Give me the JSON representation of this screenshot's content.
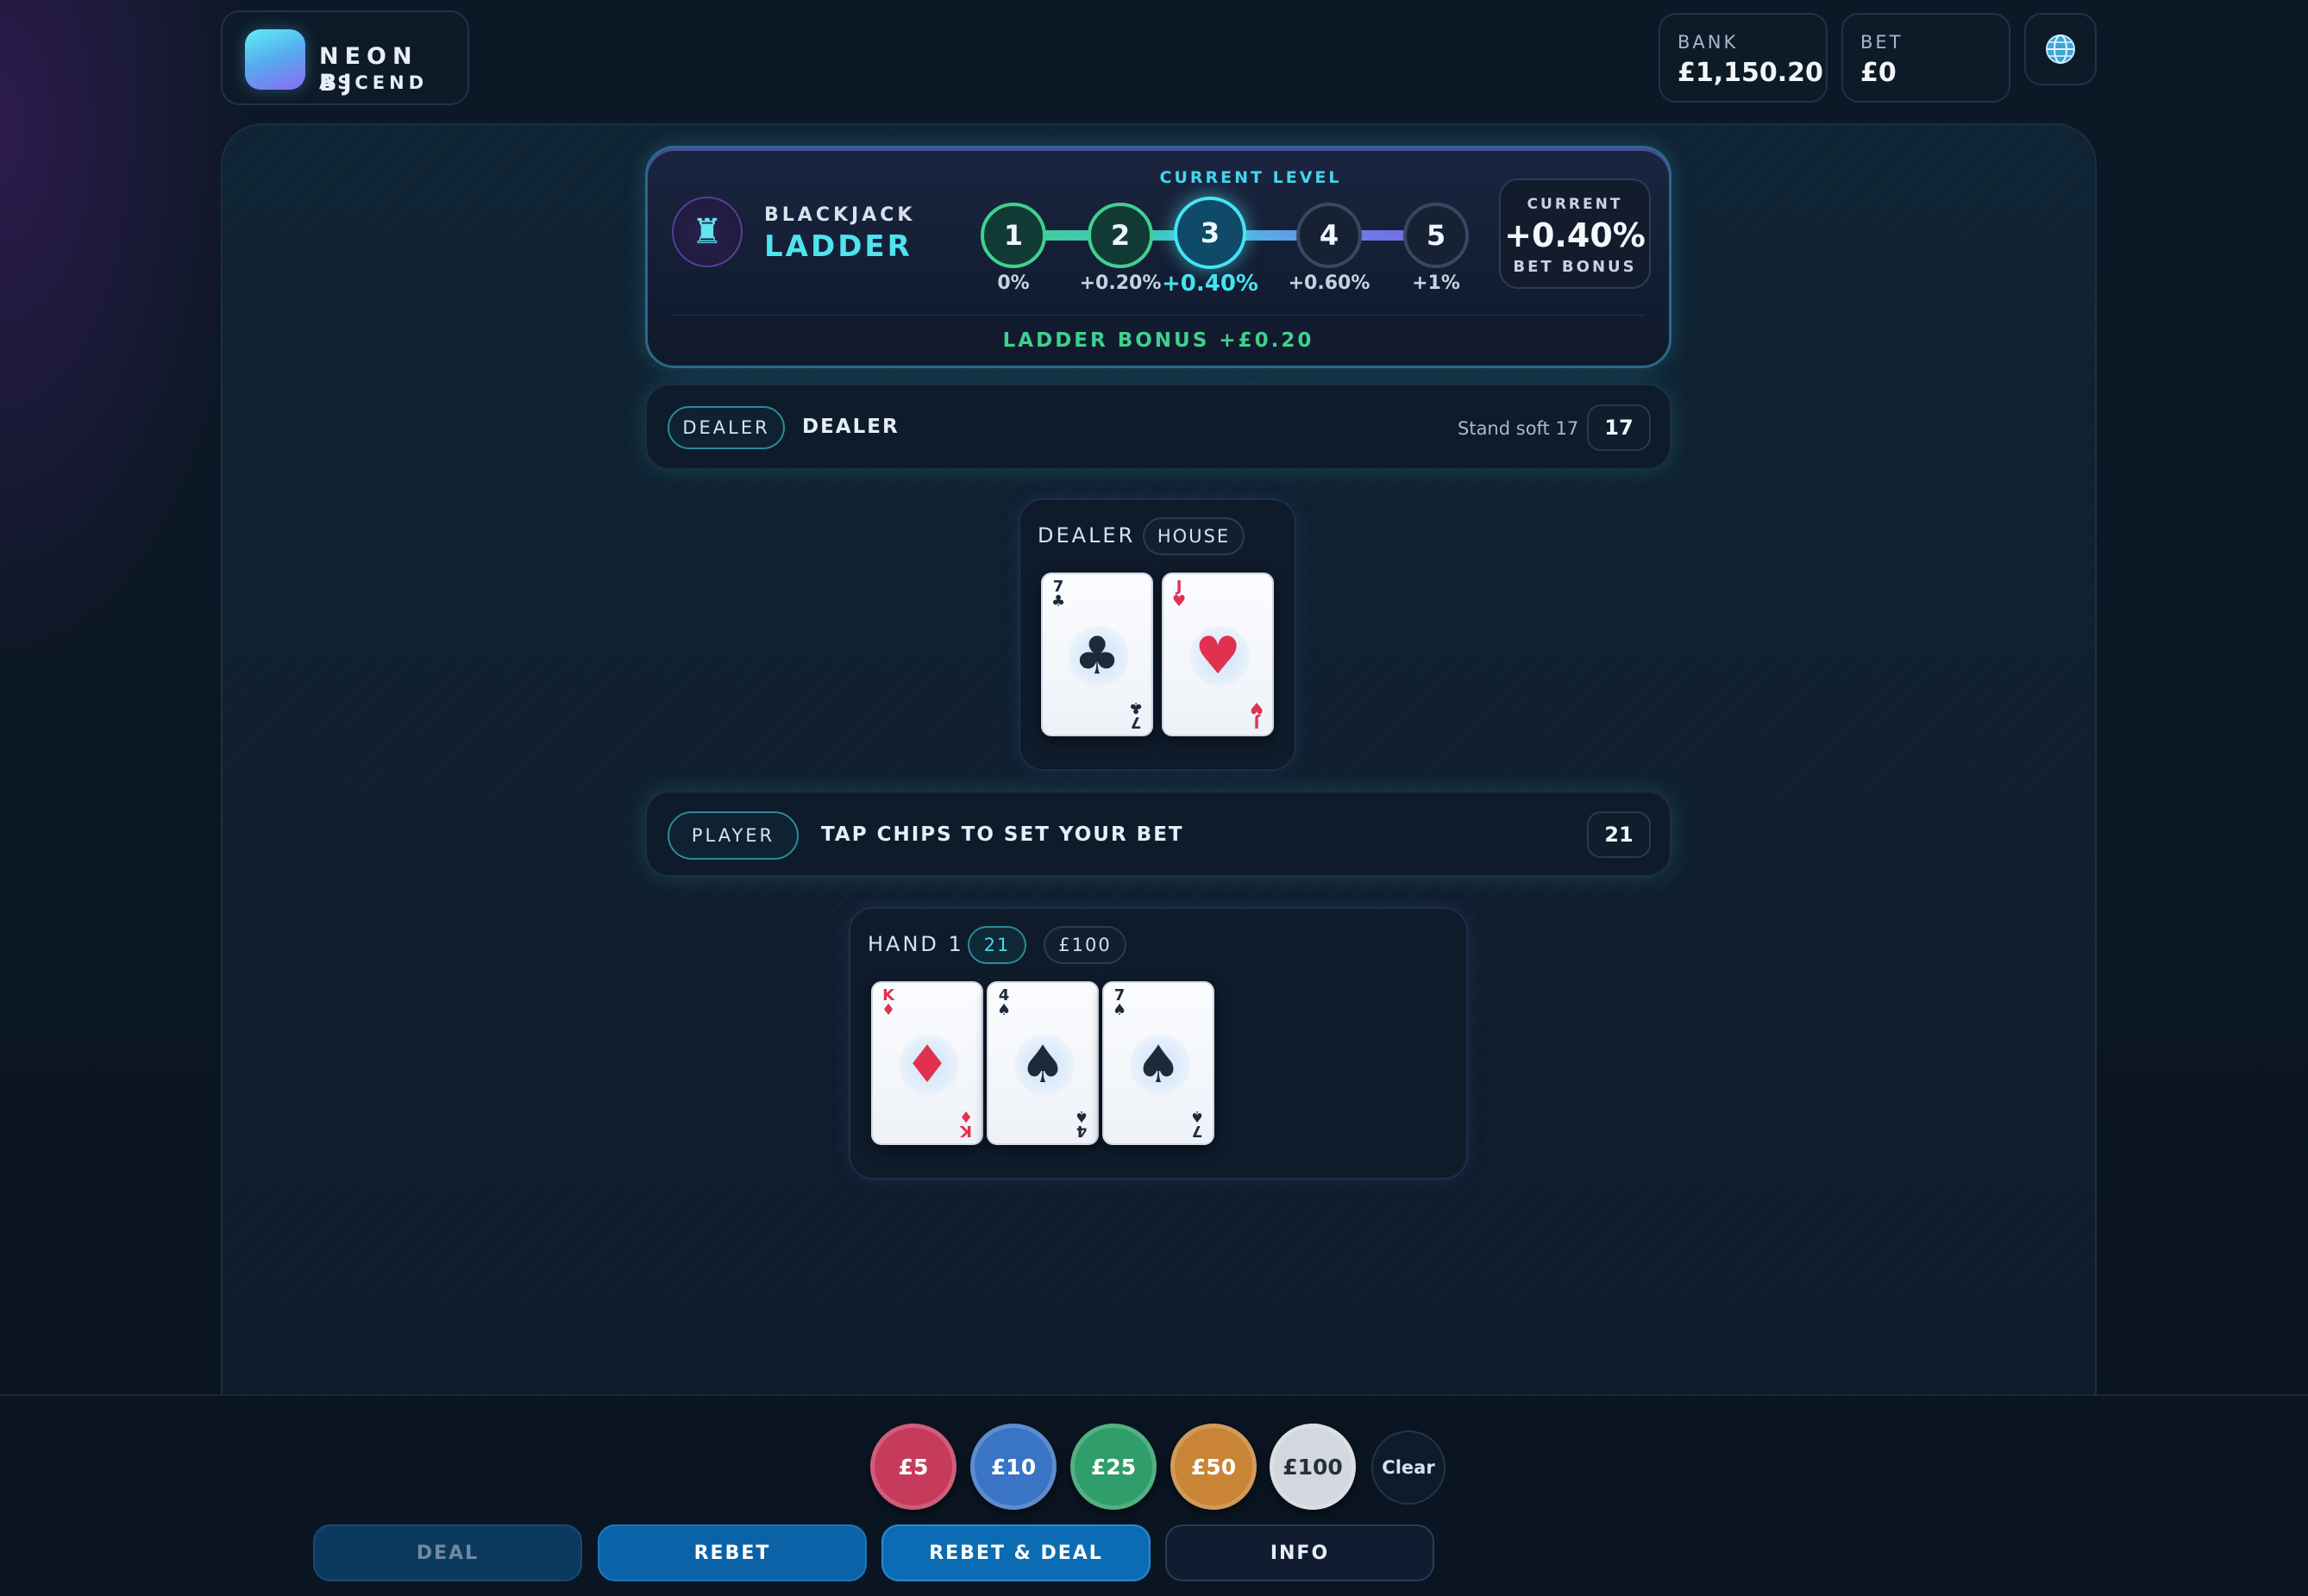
{
  "brand": {
    "line1": "NEON BJ",
    "line2": "ASCEND"
  },
  "stats": {
    "bank_label": "BANK",
    "bank_value": "£1,150.20",
    "bet_label": "BET",
    "bet_value": "£0"
  },
  "ladder": {
    "title_small": "BLACKJACK",
    "title_big": "LADDER",
    "current_level_caption": "CURRENT LEVEL",
    "levels": [
      {
        "num": "1",
        "pct": "0%",
        "state": "done"
      },
      {
        "num": "2",
        "pct": "+0.20%",
        "state": "done"
      },
      {
        "num": "3",
        "pct": "+0.40%",
        "state": "current"
      },
      {
        "num": "4",
        "pct": "+0.60%",
        "state": "locked"
      },
      {
        "num": "5",
        "pct": "+1%",
        "state": "locked"
      }
    ],
    "bonus_box": {
      "top": "CURRENT",
      "value": "+0.40%",
      "bottom": "BET BONUS"
    },
    "footer": "LADDER BONUS +£0.20"
  },
  "dealer_bar": {
    "pill": "DEALER",
    "title": "DEALER",
    "rule": "Stand soft 17",
    "score": "17"
  },
  "dealer_hand": {
    "label": "DEALER",
    "tag": "HOUSE",
    "cards": [
      {
        "rank": "7",
        "suit": "♣",
        "color": "dark"
      },
      {
        "rank": "J",
        "suit": "♥",
        "color": "red"
      }
    ]
  },
  "player_bar": {
    "pill": "PLAYER",
    "title": "TAP CHIPS TO SET YOUR BET",
    "score": "21"
  },
  "player_hand": {
    "label": "HAND 1",
    "score_tag": "21",
    "bet_tag": "£100",
    "cards": [
      {
        "rank": "K",
        "suit": "♦",
        "color": "red"
      },
      {
        "rank": "4",
        "suit": "♠",
        "color": "dark"
      },
      {
        "rank": "7",
        "suit": "♠",
        "color": "dark"
      }
    ]
  },
  "chips": [
    {
      "label": "£5",
      "color": "#c63a5c"
    },
    {
      "label": "£10",
      "color": "#3a74c4"
    },
    {
      "label": "£25",
      "color": "#2f9e6a"
    },
    {
      "label": "£50",
      "color": "#c98436"
    },
    {
      "label": "£100",
      "color": "#d3d7de"
    }
  ],
  "clear_label": "Clear",
  "actions": {
    "deal": "DEAL",
    "rebet": "REBET",
    "rebet_deal": "REBET & DEAL",
    "info": "INFO"
  },
  "icons": {
    "logo": "gradient-logo-icon",
    "globe": "globe-icon",
    "ladder": "rook-icon"
  },
  "colors": {
    "accent": "#45e4f2",
    "green": "#3fd08f",
    "red": "#e0314f"
  }
}
